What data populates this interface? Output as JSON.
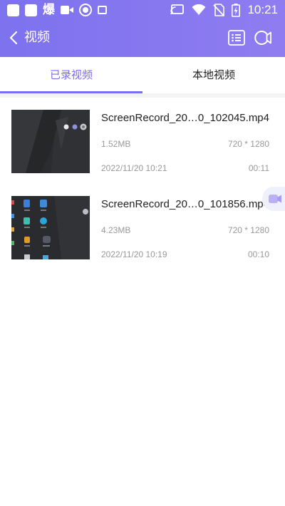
{
  "status_bar": {
    "cn_glyph": "爆",
    "time": "10:21"
  },
  "app_bar": {
    "title": "视频"
  },
  "tabs": [
    {
      "label": "已录视频",
      "active": true
    },
    {
      "label": "本地视频",
      "active": false
    }
  ],
  "videos": [
    {
      "filename": "ScreenRecord_20…0_102045.mp4",
      "size": "1.52MB",
      "resolution": "720 * 1280",
      "date": "2022/11/20 10:21",
      "duration": "00:11"
    },
    {
      "filename": "ScreenRecord_20…0_101856.mp4",
      "size": "4.23MB",
      "resolution": "720 * 1280",
      "date": "2022/11/20 10:19",
      "duration": "00:10"
    }
  ],
  "colors": {
    "header_start": "#7d72ee",
    "header_end": "#8f7cf0",
    "accent": "#7a6df0",
    "text_primary": "#222222",
    "text_secondary": "#999999"
  },
  "icons": {
    "status_left": [
      "app-square-icon",
      "app-square-icon",
      "video-camera-icon",
      "record-icon",
      "book-icon"
    ],
    "status_right": [
      "cast-icon",
      "wifi-icon",
      "no-sim-icon",
      "battery-icon"
    ],
    "app_bar": [
      "back-chevron-icon",
      "list-icon",
      "screen-record-icon"
    ],
    "floating": "floating-record-icon"
  }
}
